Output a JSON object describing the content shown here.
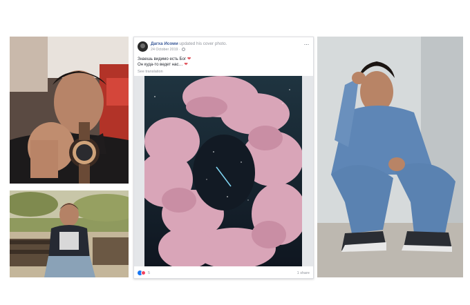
{
  "post": {
    "author": "Дагха Исоми",
    "action": " updated his cover photo.",
    "date": "24 October 2019",
    "separator": " · ",
    "text_line1": "Знаешь видимо есть Бог",
    "text_line2": "Он куда-то ведет нас…",
    "heart": "❤",
    "see_translation": "See translation",
    "more": "···",
    "reactions_count": "5",
    "shares": "1 share"
  },
  "icons": {
    "avatar": "profile-avatar",
    "privacy": "globe-icon",
    "more": "more-options-icon",
    "like": "like-reaction-icon",
    "love": "love-reaction-icon"
  },
  "colors": {
    "link": "#385898",
    "meta": "#90949c",
    "text": "#1d2129",
    "like": "#1877f2",
    "love": "#f3425f",
    "heart": "#e0535b"
  }
}
